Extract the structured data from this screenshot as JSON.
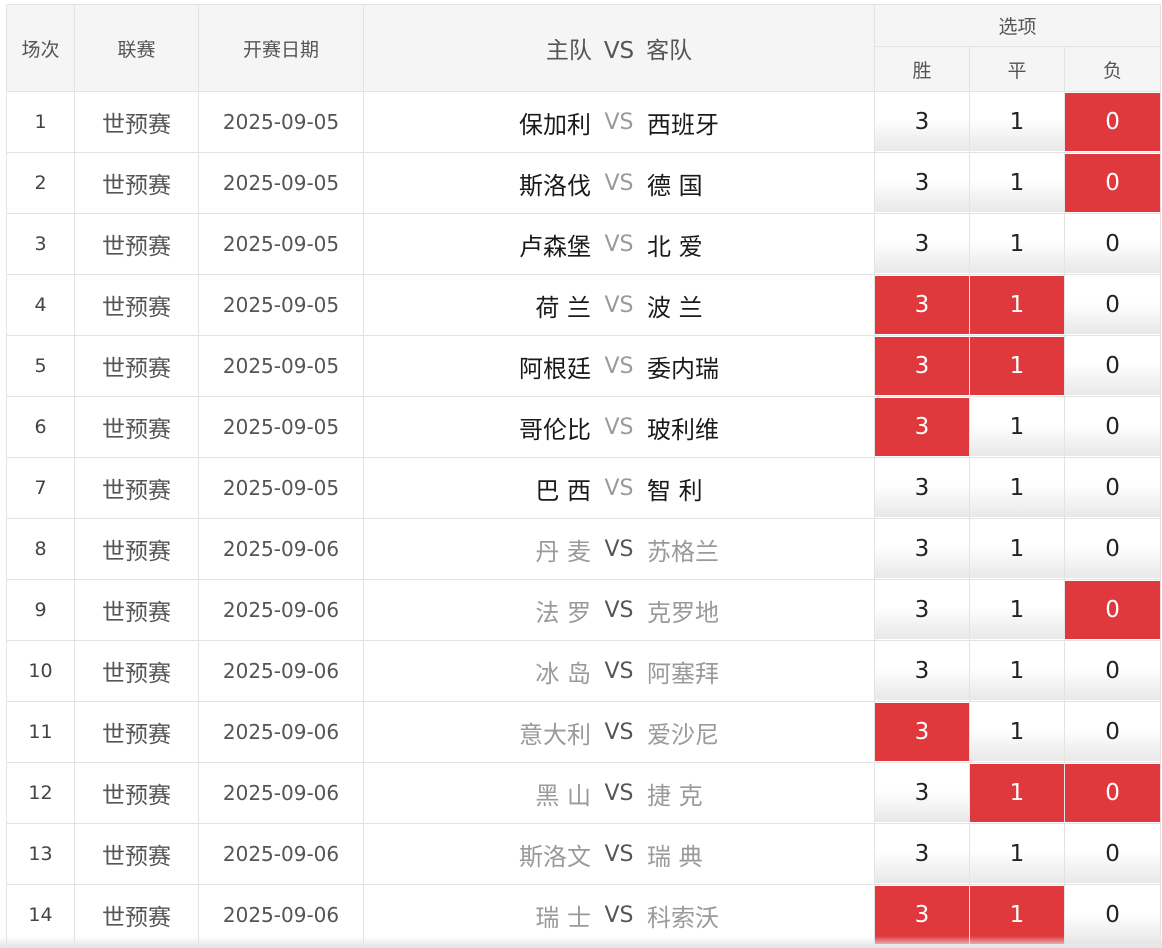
{
  "header": {
    "col_num": "场次",
    "col_league": "联赛",
    "col_date": "开赛日期",
    "col_home": "主队",
    "col_vs": "VS",
    "col_away": "客队",
    "col_options": "选项",
    "opt_win": "胜",
    "opt_draw": "平",
    "opt_lose": "负"
  },
  "colors": {
    "selected": "#e0393d",
    "border": "#e3e3e3",
    "header_bg": "#f5f5f5"
  },
  "rows": [
    {
      "num": "1",
      "league": "世预赛",
      "date": "2025-09-05",
      "home": "保加利",
      "vs": "VS",
      "away": "西班牙",
      "home_active": true,
      "away_active": true,
      "win": "3",
      "draw": "1",
      "lose": "0",
      "sel": [
        false,
        false,
        true
      ]
    },
    {
      "num": "2",
      "league": "世预赛",
      "date": "2025-09-05",
      "home": "斯洛伐",
      "vs": "VS",
      "away": "德 国",
      "home_active": true,
      "away_active": true,
      "win": "3",
      "draw": "1",
      "lose": "0",
      "sel": [
        false,
        false,
        true
      ]
    },
    {
      "num": "3",
      "league": "世预赛",
      "date": "2025-09-05",
      "home": "卢森堡",
      "vs": "VS",
      "away": "北 爱",
      "home_active": true,
      "away_active": true,
      "win": "3",
      "draw": "1",
      "lose": "0",
      "sel": [
        false,
        false,
        false
      ]
    },
    {
      "num": "4",
      "league": "世预赛",
      "date": "2025-09-05",
      "home": "荷 兰",
      "vs": "VS",
      "away": "波 兰",
      "home_active": true,
      "away_active": true,
      "win": "3",
      "draw": "1",
      "lose": "0",
      "sel": [
        true,
        true,
        false
      ]
    },
    {
      "num": "5",
      "league": "世预赛",
      "date": "2025-09-05",
      "home": "阿根廷",
      "vs": "VS",
      "away": "委内瑞",
      "home_active": true,
      "away_active": true,
      "win": "3",
      "draw": "1",
      "lose": "0",
      "sel": [
        true,
        true,
        false
      ]
    },
    {
      "num": "6",
      "league": "世预赛",
      "date": "2025-09-05",
      "home": "哥伦比",
      "vs": "VS",
      "away": "玻利维",
      "home_active": true,
      "away_active": true,
      "win": "3",
      "draw": "1",
      "lose": "0",
      "sel": [
        true,
        false,
        false
      ]
    },
    {
      "num": "7",
      "league": "世预赛",
      "date": "2025-09-05",
      "home": "巴 西",
      "vs": "VS",
      "away": "智 利",
      "home_active": true,
      "away_active": true,
      "win": "3",
      "draw": "1",
      "lose": "0",
      "sel": [
        false,
        false,
        false
      ]
    },
    {
      "num": "8",
      "league": "世预赛",
      "date": "2025-09-06",
      "home": "丹 麦",
      "vs": "VS",
      "away": "苏格兰",
      "home_active": false,
      "away_active": false,
      "win": "3",
      "draw": "1",
      "lose": "0",
      "sel": [
        false,
        false,
        false
      ]
    },
    {
      "num": "9",
      "league": "世预赛",
      "date": "2025-09-06",
      "home": "法 罗",
      "vs": "VS",
      "away": "克罗地",
      "home_active": false,
      "away_active": false,
      "win": "3",
      "draw": "1",
      "lose": "0",
      "sel": [
        false,
        false,
        true
      ]
    },
    {
      "num": "10",
      "league": "世预赛",
      "date": "2025-09-06",
      "home": "冰 岛",
      "vs": "VS",
      "away": "阿塞拜",
      "home_active": false,
      "away_active": false,
      "win": "3",
      "draw": "1",
      "lose": "0",
      "sel": [
        false,
        false,
        false
      ]
    },
    {
      "num": "11",
      "league": "世预赛",
      "date": "2025-09-06",
      "home": "意大利",
      "vs": "VS",
      "away": "爱沙尼",
      "home_active": false,
      "away_active": false,
      "win": "3",
      "draw": "1",
      "lose": "0",
      "sel": [
        true,
        false,
        false
      ]
    },
    {
      "num": "12",
      "league": "世预赛",
      "date": "2025-09-06",
      "home": "黑 山",
      "vs": "VS",
      "away": "捷 克",
      "home_active": false,
      "away_active": false,
      "win": "3",
      "draw": "1",
      "lose": "0",
      "sel": [
        false,
        true,
        true
      ]
    },
    {
      "num": "13",
      "league": "世预赛",
      "date": "2025-09-06",
      "home": "斯洛文",
      "vs": "VS",
      "away": "瑞 典",
      "home_active": false,
      "away_active": false,
      "win": "3",
      "draw": "1",
      "lose": "0",
      "sel": [
        false,
        false,
        false
      ]
    },
    {
      "num": "14",
      "league": "世预赛",
      "date": "2025-09-06",
      "home": "瑞 士",
      "vs": "VS",
      "away": "科索沃",
      "home_active": false,
      "away_active": false,
      "win": "3",
      "draw": "1",
      "lose": "0",
      "sel": [
        true,
        true,
        false
      ]
    }
  ]
}
